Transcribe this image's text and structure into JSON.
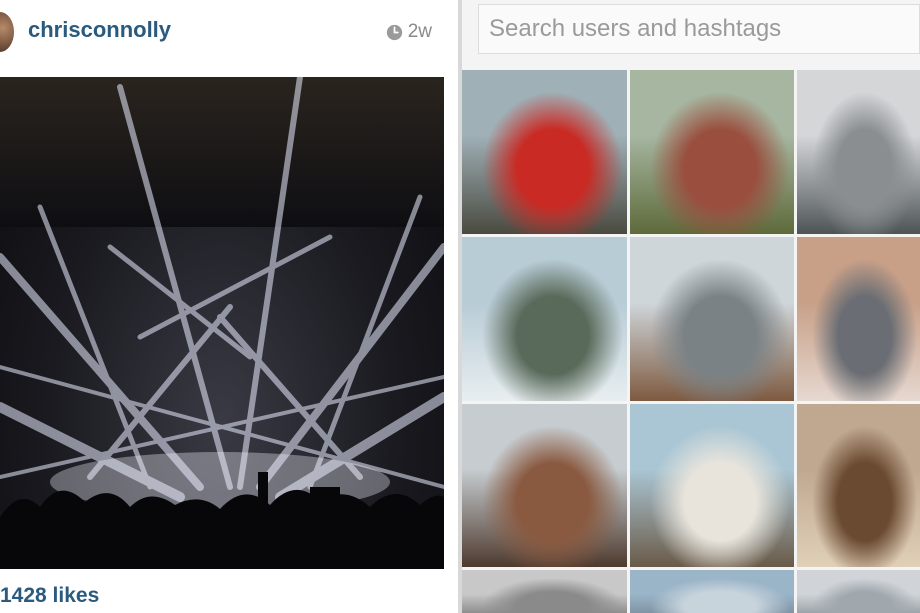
{
  "post": {
    "username": "chrisconnolly",
    "time": "2w",
    "likes": "1428 likes"
  },
  "explore": {
    "search_placeholder": "Search users and hashtags",
    "tiles": [
      {
        "name": "tile-red-beetle",
        "colors": [
          "#9fb0b6",
          "#c92a24",
          "#4a4a40"
        ]
      },
      {
        "name": "tile-brick-tower",
        "colors": [
          "#a6b6a0",
          "#9a4e3e",
          "#5e6a3a"
        ]
      },
      {
        "name": "tile-city-aerial",
        "colors": [
          "#d4d6d8",
          "#8a8e90",
          "#4e5456"
        ]
      },
      {
        "name": "tile-snowy-mountains",
        "colors": [
          "#b8ccd6",
          "#5a6a5a",
          "#e8eef0"
        ]
      },
      {
        "name": "tile-glass-dome",
        "colors": [
          "#cfd6da",
          "#7a8286",
          "#7e5a40"
        ]
      },
      {
        "name": "tile-laptop-flowers",
        "colors": [
          "#c8a088",
          "#6a6e74",
          "#e6d8d0"
        ]
      },
      {
        "name": "tile-stone-wall",
        "colors": [
          "#c6ccd0",
          "#8a5a40",
          "#4e3a2e"
        ]
      },
      {
        "name": "tile-lighthouse",
        "colors": [
          "#aac6d4",
          "#e8e4dc",
          "#6a5a48"
        ]
      },
      {
        "name": "tile-guitar",
        "colors": [
          "#c0a890",
          "#6a4a30",
          "#e0d0b8"
        ]
      },
      {
        "name": "tile-bottom-1",
        "colors": [
          "#c8c8c8",
          "#8a8a8a",
          "#5a5a5a"
        ]
      },
      {
        "name": "tile-bottom-2",
        "colors": [
          "#9ab4c8",
          "#c8d4dc",
          "#6a7a86"
        ]
      },
      {
        "name": "tile-bottom-3",
        "colors": [
          "#d0d4d8",
          "#a0a8ae",
          "#707a80"
        ]
      }
    ]
  }
}
